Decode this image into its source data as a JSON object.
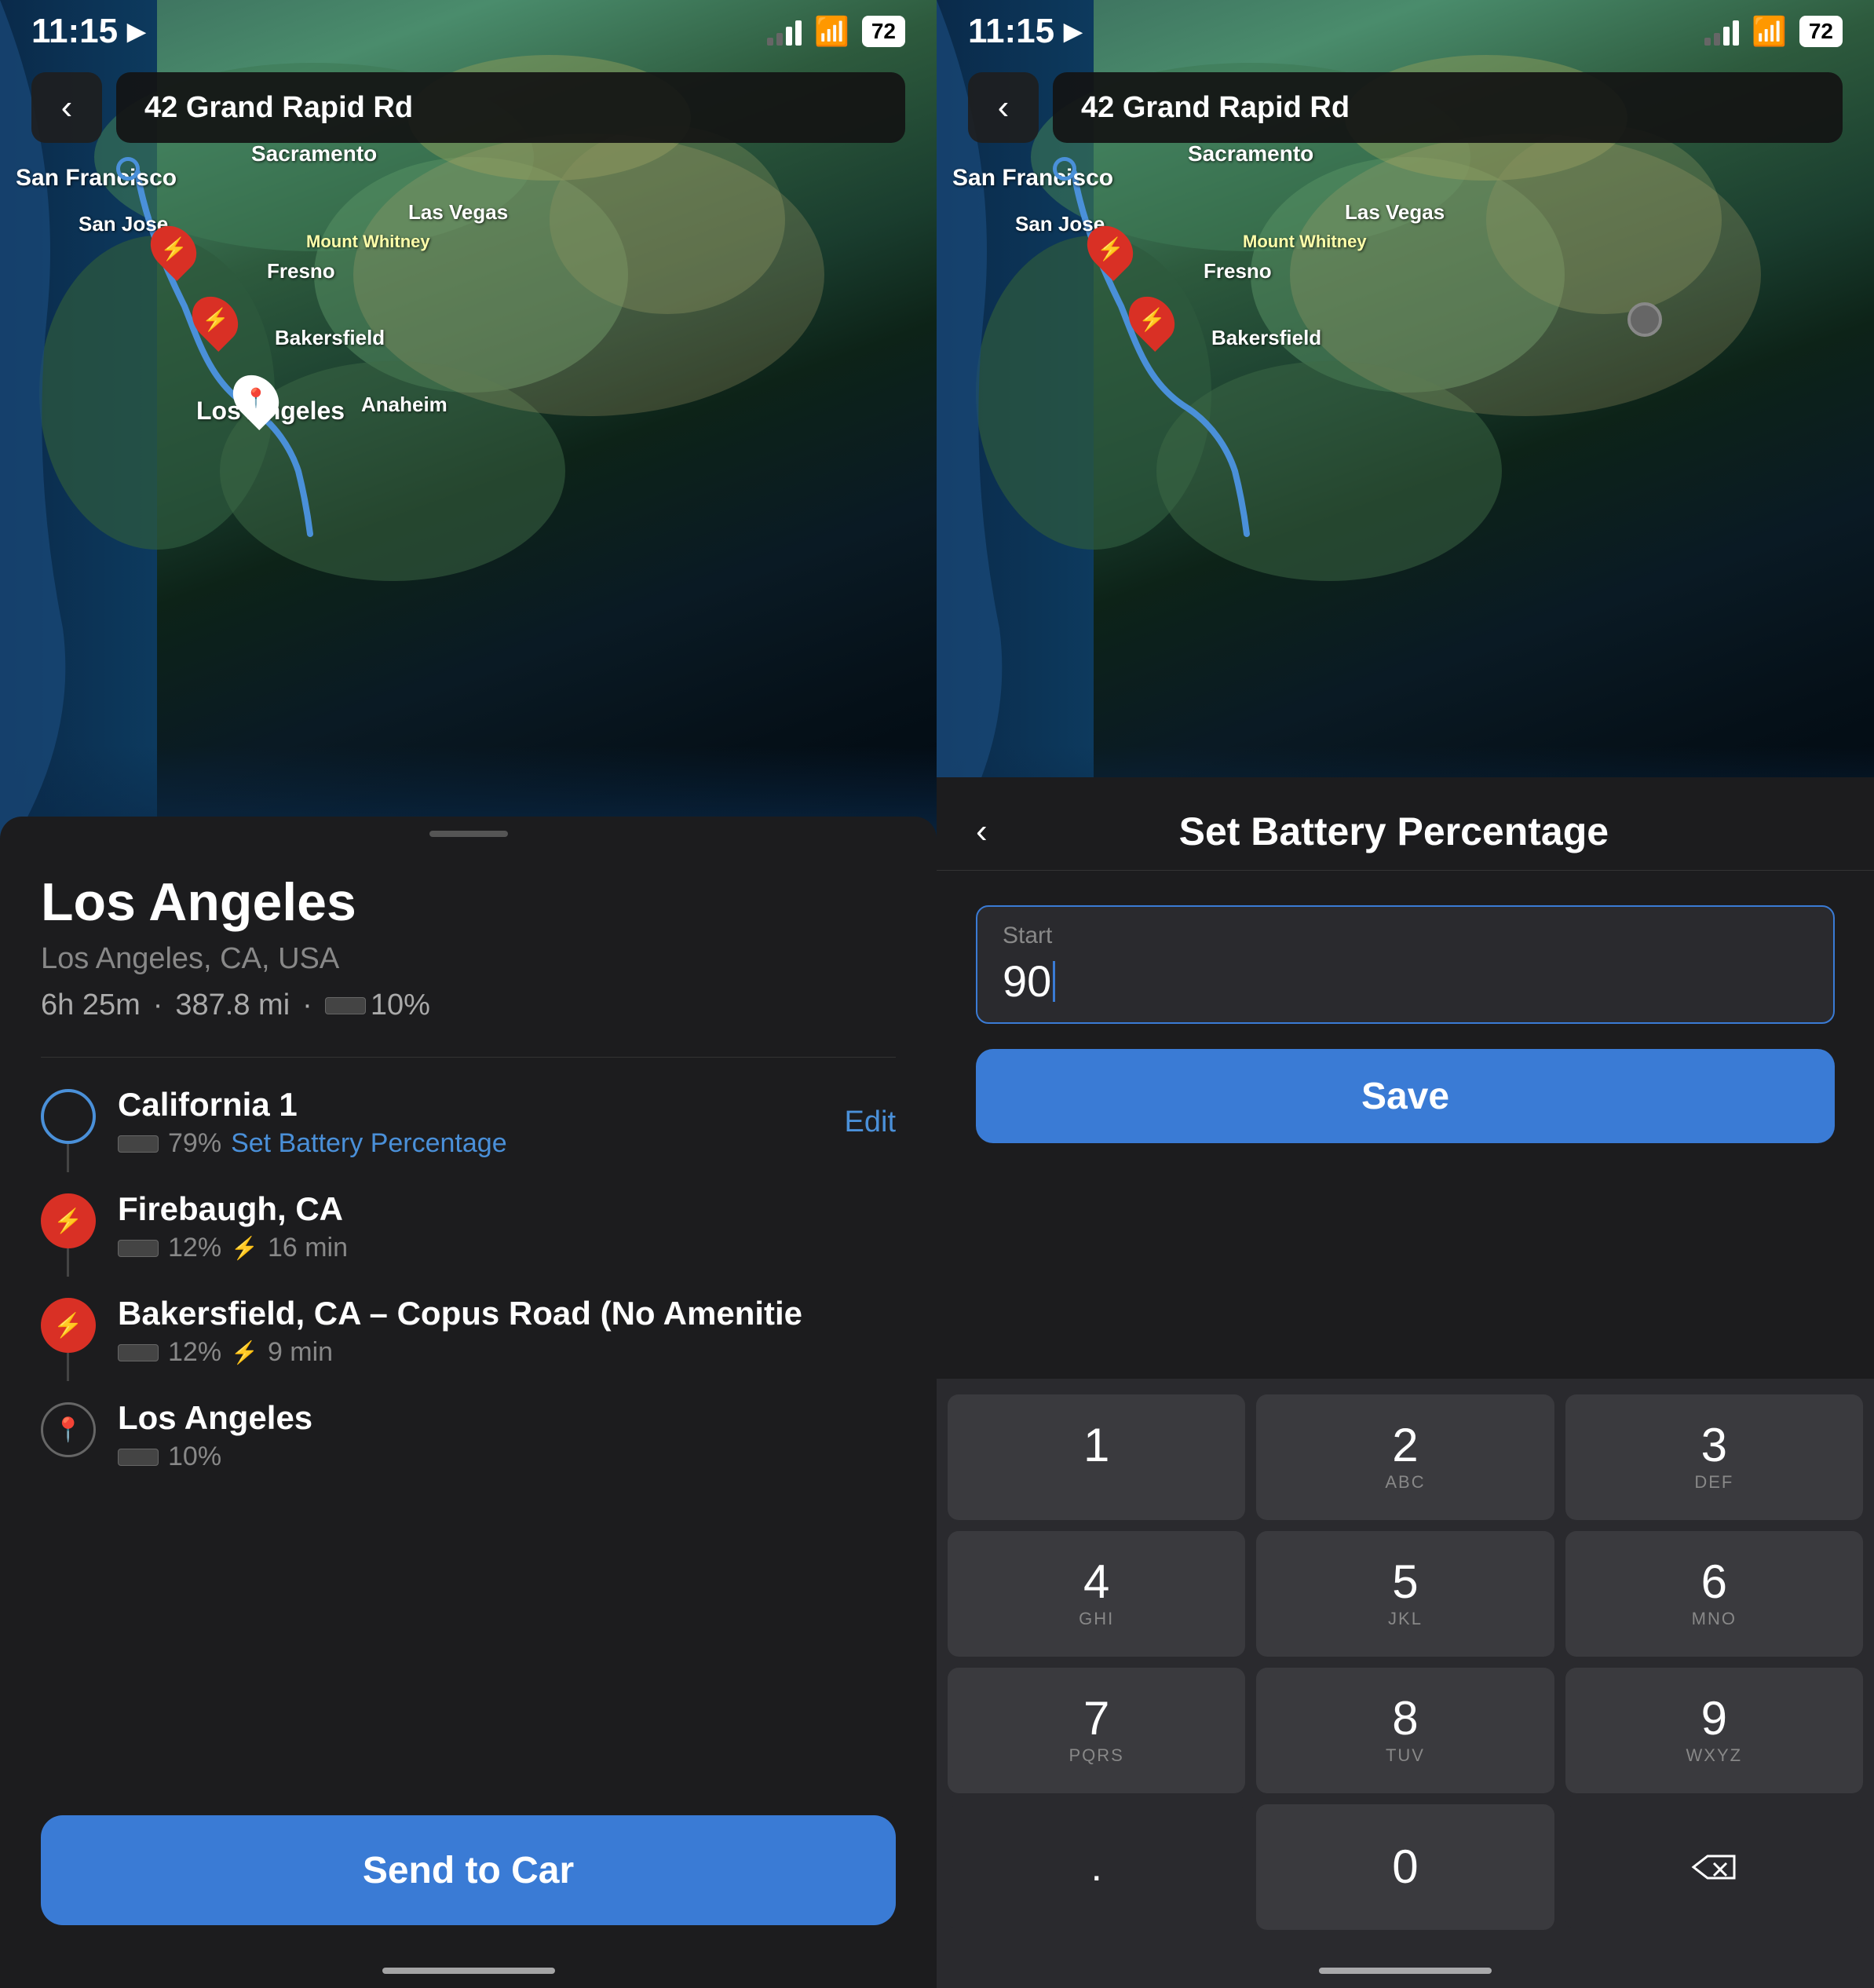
{
  "left_panel": {
    "status": {
      "time": "11:15",
      "battery": "72"
    },
    "address": "42 Grand Rapid Rd",
    "map_labels": {
      "sacramento": "Sacramento",
      "san_francisco": "San Francisco",
      "san_jose": "San Jose",
      "fresno": "Fresno",
      "mount_whitney": "Mount Whitney",
      "las_vegas": "Las Vegas",
      "bakersfield": "Bakersfield",
      "los_angeles": "Los Angeles",
      "anaheim": "Anaheim"
    },
    "destination": {
      "title": "Los Angeles",
      "subtitle": "Los Angeles, CA, USA",
      "trip_time": "6h 25m",
      "trip_distance": "387.8 mi",
      "battery_percent": "10%"
    },
    "route_stops": [
      {
        "name": "California 1",
        "battery": "79%",
        "battery_link": "Set Battery Percentage",
        "edit_label": "Edit",
        "type": "start"
      },
      {
        "name": "Firebaugh, CA",
        "battery": "12%",
        "charge_time": "16 min",
        "type": "charger"
      },
      {
        "name": "Bakersfield, CA – Copus Road (No Amenitie",
        "battery": "12%",
        "charge_time": "9 min",
        "type": "charger"
      },
      {
        "name": "Los Angeles",
        "battery": "10%",
        "type": "destination"
      }
    ],
    "send_to_car_label": "Send to Car"
  },
  "right_panel": {
    "status": {
      "time": "11:15",
      "battery": "72"
    },
    "address": "42 Grand Rapid Rd",
    "sheet": {
      "title": "Set Battery Percentage",
      "back_label": "‹",
      "input_label": "Start",
      "input_value": "90",
      "save_label": "Save"
    },
    "keypad": {
      "keys": [
        {
          "num": "1",
          "letters": ""
        },
        {
          "num": "2",
          "letters": "ABC"
        },
        {
          "num": "3",
          "letters": "DEF"
        },
        {
          "num": "4",
          "letters": "GHI"
        },
        {
          "num": "5",
          "letters": "JKL"
        },
        {
          "num": "6",
          "letters": "MNO"
        },
        {
          "num": "7",
          "letters": "PQRS"
        },
        {
          "num": "8",
          "letters": "TUV"
        },
        {
          "num": "9",
          "letters": "WXYZ"
        },
        {
          "num": ".",
          "letters": ""
        },
        {
          "num": "0",
          "letters": ""
        },
        {
          "num": "⌫",
          "letters": ""
        }
      ]
    }
  }
}
